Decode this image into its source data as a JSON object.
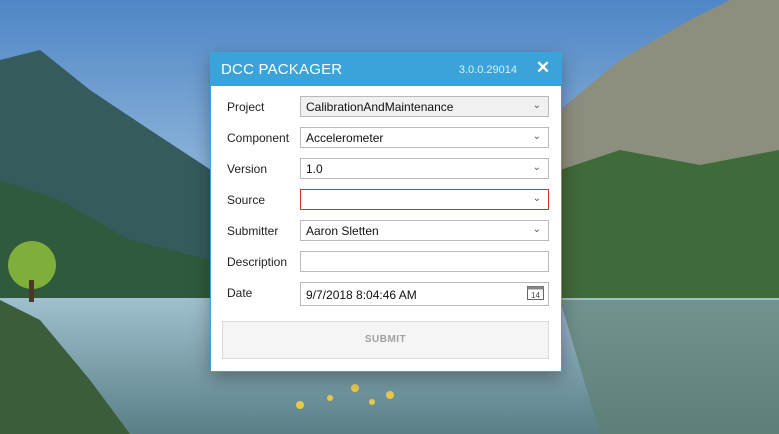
{
  "window": {
    "title": "DCC PACKAGER",
    "version": "3.0.0.29014",
    "close_label": "✕"
  },
  "form": {
    "project": {
      "label": "Project",
      "value": "CalibrationAndMaintenance"
    },
    "component": {
      "label": "Component",
      "value": "Accelerometer"
    },
    "version": {
      "label": "Version",
      "value": "1.0"
    },
    "source": {
      "label": "Source",
      "value": ""
    },
    "submitter": {
      "label": "Submitter",
      "value": "Aaron Sletten"
    },
    "description": {
      "label": "Description",
      "value": ""
    },
    "date": {
      "label": "Date",
      "value": "9/7/2018 8:04:46 AM",
      "calendar_day": "14"
    }
  },
  "submit_label": "SUBMIT",
  "colors": {
    "accent": "#3aa3d9",
    "error_border": "#d33131"
  }
}
